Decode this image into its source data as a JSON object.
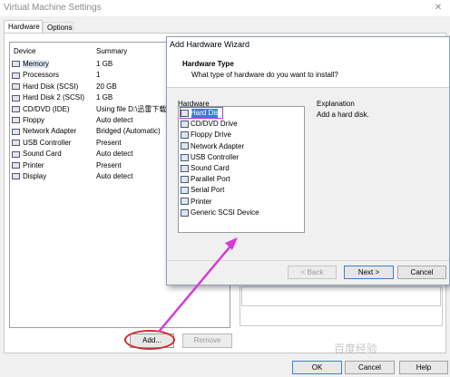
{
  "main_window": {
    "title": "Virtual Machine Settings",
    "close_glyph": "✕",
    "tabs": [
      {
        "label": "Hardware",
        "active": true
      },
      {
        "label": "Options",
        "active": false
      }
    ],
    "table": {
      "headers": [
        "Device",
        "Summary"
      ],
      "rows": [
        {
          "device": "Memory",
          "summary": "1 GB",
          "icon": "memory-icon",
          "selected": true
        },
        {
          "device": "Processors",
          "summary": "1",
          "icon": "processor-icon"
        },
        {
          "device": "Hard Disk (SCSI)",
          "summary": "20 GB",
          "icon": "hard-disk-icon"
        },
        {
          "device": "Hard Disk 2 (SCSI)",
          "summary": "1 GB",
          "icon": "hard-disk-icon"
        },
        {
          "device": "CD/DVD (IDE)",
          "summary": "Using file D:\\迅雷下载",
          "icon": "cd-dvd-icon"
        },
        {
          "device": "Floppy",
          "summary": "Auto detect",
          "icon": "floppy-icon"
        },
        {
          "device": "Network Adapter",
          "summary": "Bridged (Automatic)",
          "icon": "network-icon"
        },
        {
          "device": "USB Controller",
          "summary": "Present",
          "icon": "usb-icon"
        },
        {
          "device": "Sound Card",
          "summary": "Auto detect",
          "icon": "sound-icon"
        },
        {
          "device": "Printer",
          "summary": "Present",
          "icon": "printer-icon"
        },
        {
          "device": "Display",
          "summary": "Auto detect",
          "icon": "display-icon"
        }
      ]
    },
    "add_label": "Add...",
    "remove_label": "Remove",
    "ok_label": "OK",
    "cancel_label": "Cancel",
    "help_label": "Help",
    "watermark": "百度经验"
  },
  "wizard": {
    "title": "Add Hardware Wizard",
    "header_title": "Hardware Type",
    "header_subtitle": "What type of hardware do you want to install?",
    "hardware_label": "Hardware",
    "items": [
      {
        "label": "Hard Disk",
        "icon": "hard-disk-icon",
        "selected": true
      },
      {
        "label": "CD/DVD Drive",
        "icon": "cd-dvd-icon"
      },
      {
        "label": "Floppy Drive",
        "icon": "floppy-icon"
      },
      {
        "label": "Network Adapter",
        "icon": "network-icon"
      },
      {
        "label": "USB Controller",
        "icon": "usb-icon"
      },
      {
        "label": "Sound Card",
        "icon": "sound-icon"
      },
      {
        "label": "Parallel Port",
        "icon": "parallel-port-icon"
      },
      {
        "label": "Serial Port",
        "icon": "serial-port-icon"
      },
      {
        "label": "Printer",
        "icon": "printer-icon"
      },
      {
        "label": "Generic SCSI Device",
        "icon": "scsi-icon"
      }
    ],
    "explanation_label": "Explanation",
    "explanation_text": "Add a hard disk.",
    "back_label": "< Back",
    "next_label": "Next >",
    "cancel_label": "Cancel"
  },
  "annotations": {
    "arrow_color": "#d63ad8",
    "circle_color": "#d12a2a",
    "highlight_color": "#b03adf"
  }
}
